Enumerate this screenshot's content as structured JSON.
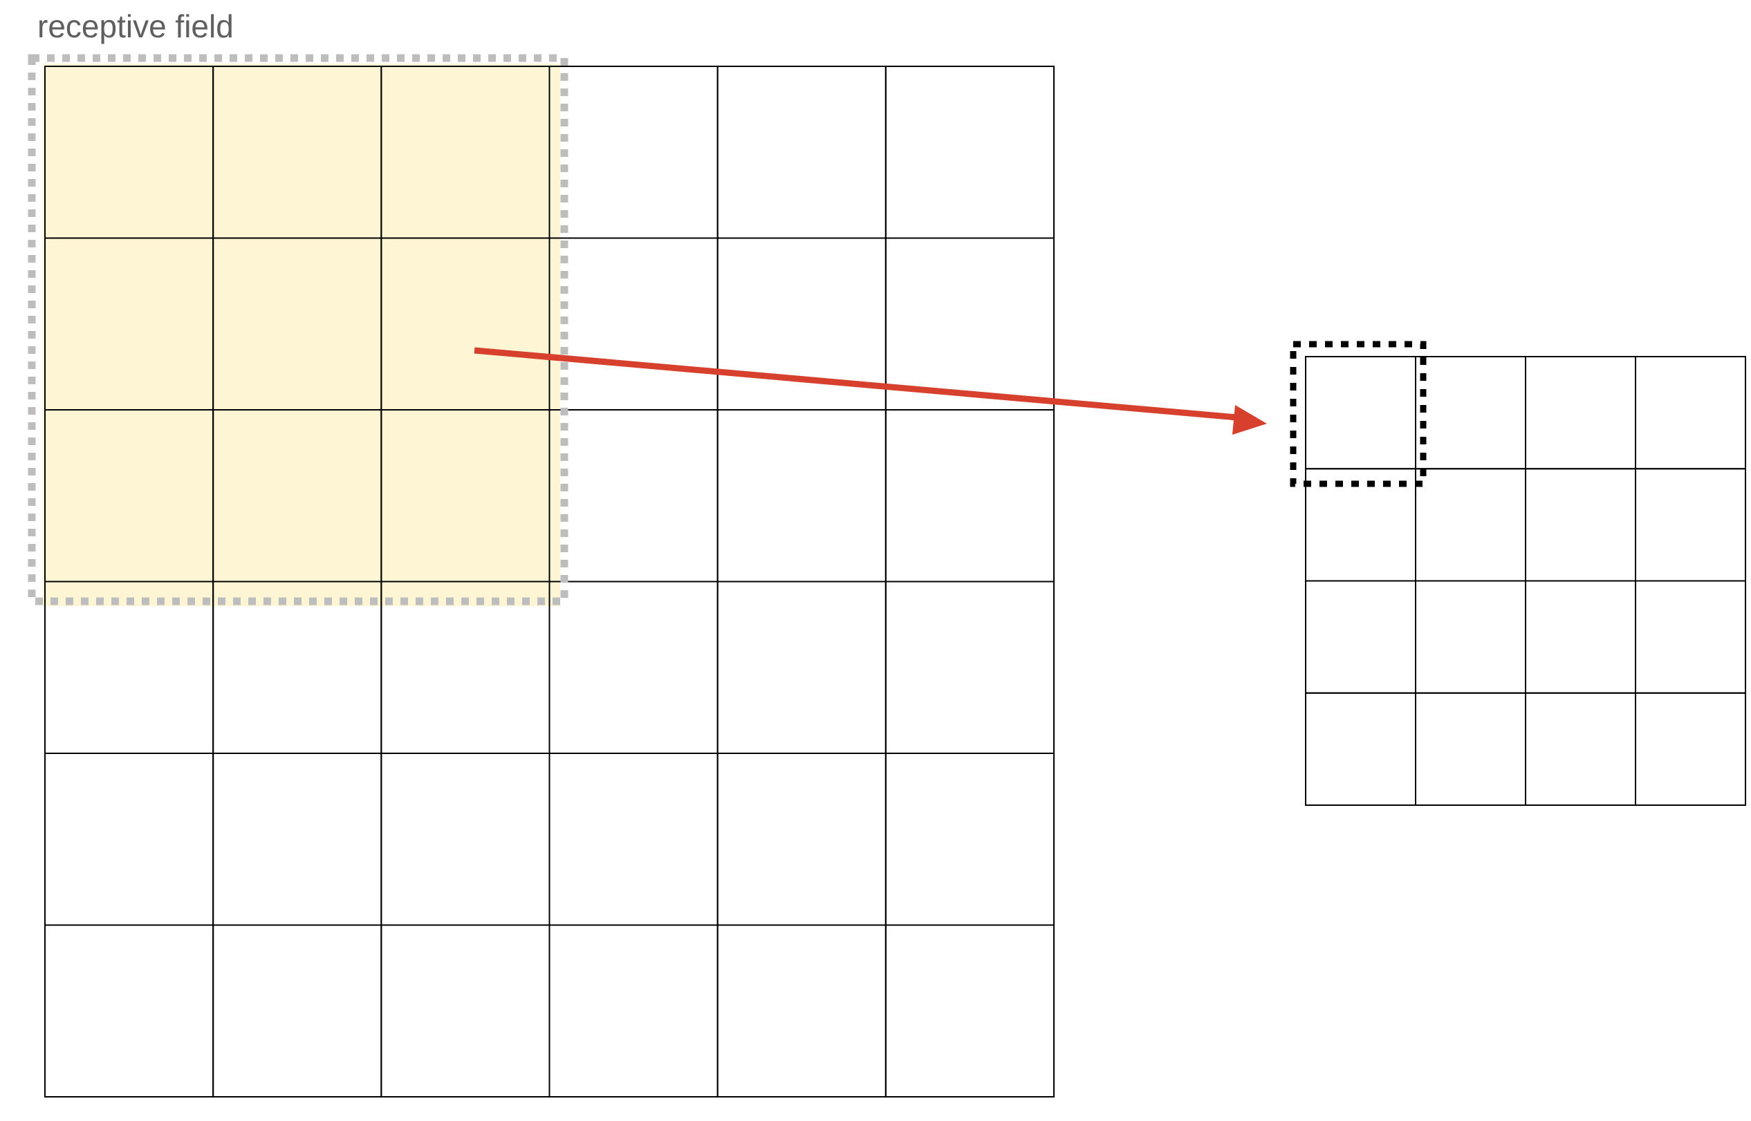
{
  "label": {
    "receptive_field": "receptive field"
  },
  "input_grid": {
    "rows": 6,
    "cols": 6
  },
  "output_grid": {
    "rows": 4,
    "cols": 4
  },
  "receptive_field": {
    "rows": 3,
    "cols": 3,
    "start_row": 0,
    "start_col": 0
  },
  "output_cell": {
    "row": 0,
    "col": 0
  },
  "colors": {
    "highlight_fill": "#fdf5d3",
    "receptive_border": "#bdbdbd",
    "output_border": "#000000",
    "arrow": "#d6402c",
    "grid_line": "#000000",
    "label_text": "#5f5f5f"
  }
}
